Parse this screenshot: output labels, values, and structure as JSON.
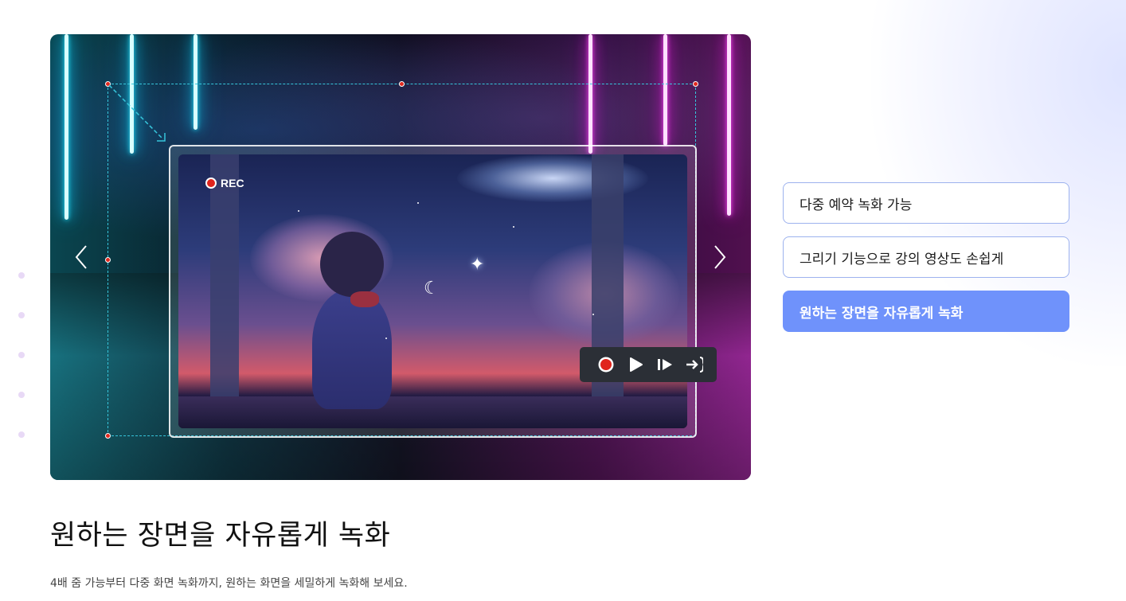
{
  "media": {
    "rec_label": "REC",
    "prev_icon": "chevron-left-icon",
    "next_icon": "chevron-right-icon",
    "controls": [
      "record-icon",
      "play-icon",
      "step-forward-icon",
      "trim-icon"
    ]
  },
  "tabs": [
    {
      "label": "다중 예약 녹화 가능",
      "active": false
    },
    {
      "label": "그리기 기능으로 강의 영상도 손쉽게",
      "active": false
    },
    {
      "label": "원하는 장면을 자유롭게 녹화",
      "active": true
    }
  ],
  "section": {
    "title": "원하는 장면을 자유롭게 녹화",
    "description": "4배 줌 가능부터 다중 화면 녹화까지, 원하는 화면을 세밀하게 녹화해 보세요."
  },
  "colors": {
    "accent": "#6f92fb",
    "tab_border": "#9db2ee",
    "rec_red": "#e0241c",
    "selection_dash": "#36c6dc"
  }
}
